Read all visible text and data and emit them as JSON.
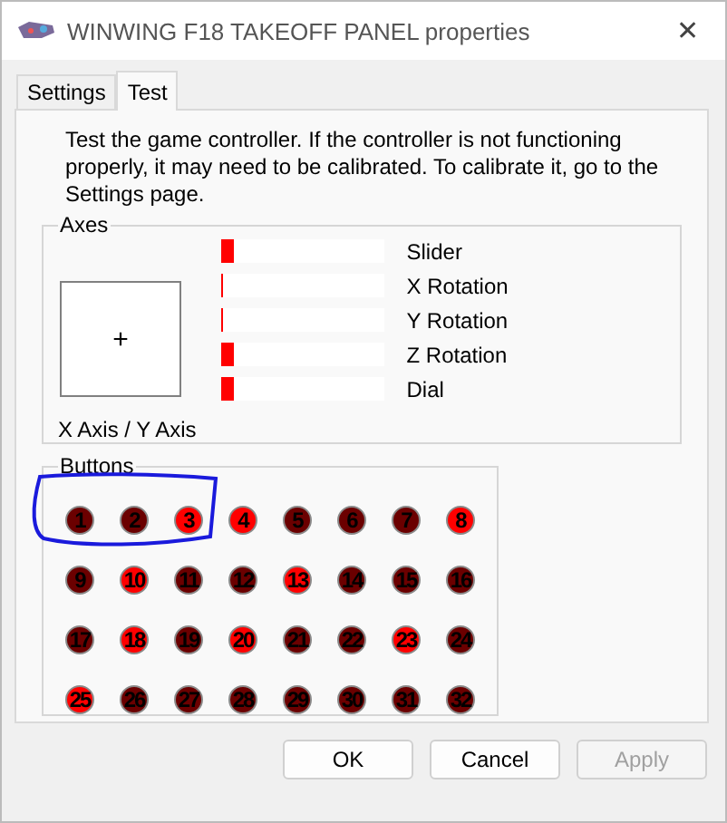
{
  "window": {
    "title": "WINWING F18 TAKEOFF PANEL properties",
    "close": "✕"
  },
  "tabs": [
    {
      "label": "Settings",
      "selected": false
    },
    {
      "label": "Test",
      "selected": true
    }
  ],
  "description": "Test the game controller.  If the controller is not functioning properly, it may need to be calibrated.  To calibrate it, go to the Settings page.",
  "axes": {
    "title": "Axes",
    "xy_label": "X Axis / Y Axis",
    "crosshair": "+",
    "bars": [
      {
        "label": "Slider",
        "level": 0.07
      },
      {
        "label": "X Rotation",
        "level": 0.01
      },
      {
        "label": "Y Rotation",
        "level": 0.01
      },
      {
        "label": "Z Rotation",
        "level": 0.07
      },
      {
        "label": "Dial",
        "level": 0.07
      }
    ]
  },
  "buttons_group": {
    "title": "Buttons",
    "buttons": [
      {
        "label": "1",
        "on": false
      },
      {
        "label": "2",
        "on": false
      },
      {
        "label": "3",
        "on": true
      },
      {
        "label": "4",
        "on": true
      },
      {
        "label": "5",
        "on": false
      },
      {
        "label": "6",
        "on": false
      },
      {
        "label": "7",
        "on": false
      },
      {
        "label": "8",
        "on": true
      },
      {
        "label": "9",
        "on": false
      },
      {
        "label": "10",
        "on": true
      },
      {
        "label": "11",
        "on": false
      },
      {
        "label": "12",
        "on": false
      },
      {
        "label": "13",
        "on": true
      },
      {
        "label": "14",
        "on": false
      },
      {
        "label": "15",
        "on": false
      },
      {
        "label": "16",
        "on": false
      },
      {
        "label": "17",
        "on": false
      },
      {
        "label": "18",
        "on": true
      },
      {
        "label": "19",
        "on": false
      },
      {
        "label": "20",
        "on": true
      },
      {
        "label": "21",
        "on": false
      },
      {
        "label": "22",
        "on": false
      },
      {
        "label": "23",
        "on": true
      },
      {
        "label": "24",
        "on": false
      },
      {
        "label": "25",
        "on": true
      },
      {
        "label": "26",
        "on": false
      },
      {
        "label": "27",
        "on": false
      },
      {
        "label": "28",
        "on": false
      },
      {
        "label": "29",
        "on": false
      },
      {
        "label": "30",
        "on": false
      },
      {
        "label": "31",
        "on": false
      },
      {
        "label": "32",
        "on": false
      }
    ]
  },
  "dialog_buttons": [
    {
      "label": "OK",
      "disabled": false
    },
    {
      "label": "Cancel",
      "disabled": false
    },
    {
      "label": "Apply",
      "disabled": true
    }
  ]
}
